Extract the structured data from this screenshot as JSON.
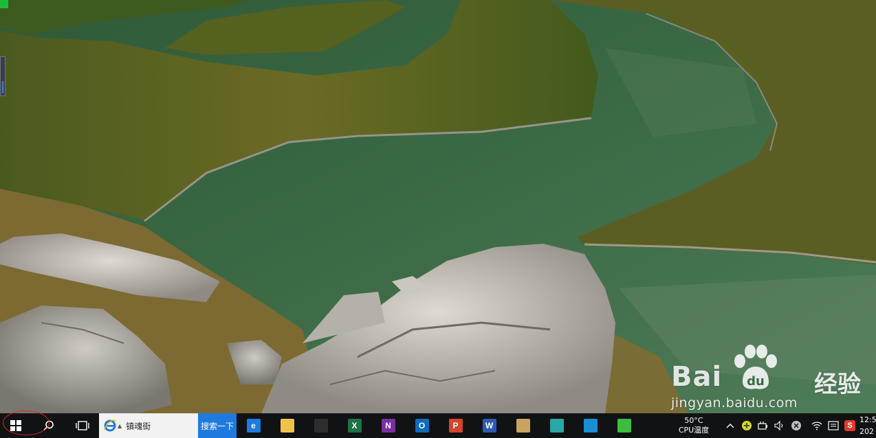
{
  "watermark": {
    "brand": "Bai",
    "brand_suffix": "经验",
    "url": "jingyan.baidu.com"
  },
  "taskbar": {
    "search_text": "镇魂街",
    "search_button": "搜索一下",
    "apps": [
      {
        "name": "edge",
        "icon": "edge-icon",
        "label": "e",
        "color": "#1e7be0"
      },
      {
        "name": "file-explorer",
        "icon": "folder-icon",
        "label": "",
        "color": "#f0c24a"
      },
      {
        "name": "store",
        "icon": "store-icon",
        "label": "",
        "color": "#2d2d2d"
      },
      {
        "name": "excel",
        "icon": "excel-icon",
        "label": "X",
        "color": "#1f7244"
      },
      {
        "name": "onenote",
        "icon": "onenote-icon",
        "label": "N",
        "color": "#7b2fa6"
      },
      {
        "name": "outlook",
        "icon": "outlook-icon",
        "label": "O",
        "color": "#0f6cbd"
      },
      {
        "name": "powerpoint",
        "icon": "powerpoint-icon",
        "label": "P",
        "color": "#d2462a"
      },
      {
        "name": "word",
        "icon": "word-icon",
        "label": "W",
        "color": "#2b5bb5"
      },
      {
        "name": "paint",
        "icon": "palette-icon",
        "label": "",
        "color": "#c9a45e"
      },
      {
        "name": "photos",
        "icon": "photos-icon",
        "label": "",
        "color": "#2aa7a7"
      },
      {
        "name": "settings",
        "icon": "gear-icon",
        "label": "",
        "color": "#1a8fd6"
      },
      {
        "name": "refresh-app",
        "icon": "refresh-icon",
        "label": "",
        "color": "#3bbf3f"
      }
    ],
    "cpu_temp_value": "50°C",
    "cpu_temp_label": "CPU温度",
    "clock_time": "12:5",
    "clock_date": "202"
  }
}
